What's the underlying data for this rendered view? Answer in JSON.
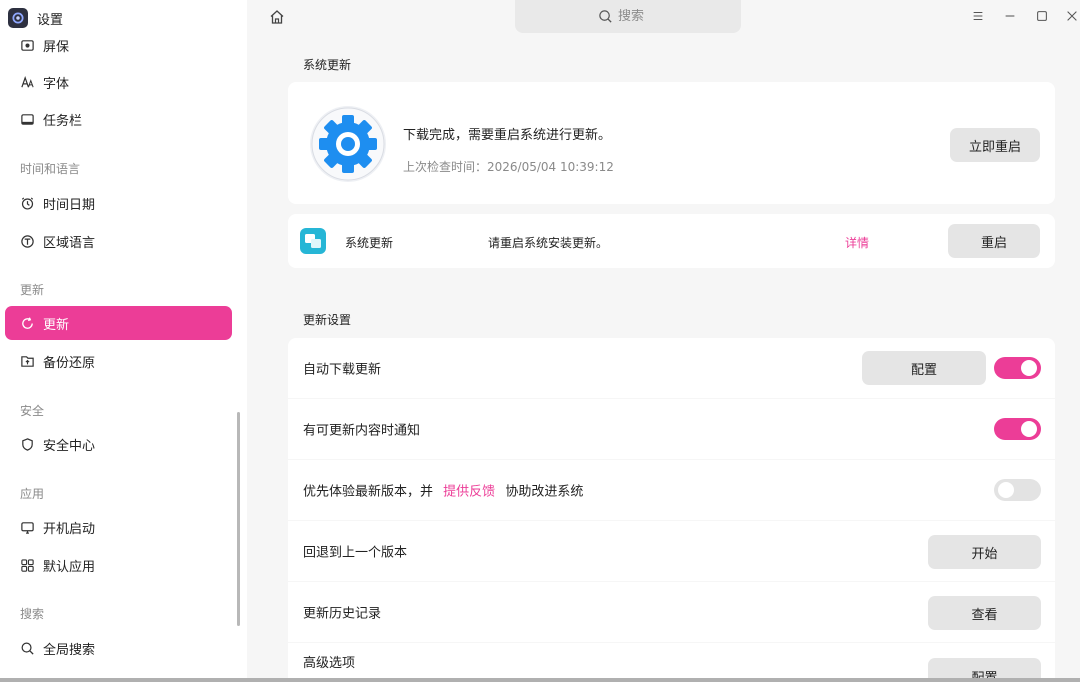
{
  "app": {
    "title": "设置"
  },
  "search": {
    "placeholder": "搜索"
  },
  "sidebar": {
    "items_top": [
      {
        "label": "屏保",
        "icon": "screensaver-icon"
      },
      {
        "label": "字体",
        "icon": "font-icon"
      },
      {
        "label": "任务栏",
        "icon": "taskbar-icon"
      }
    ],
    "section_time": "时间和语言",
    "items_time": [
      {
        "label": "时间日期",
        "icon": "clock-icon"
      },
      {
        "label": "区域语言",
        "icon": "language-icon"
      }
    ],
    "section_update": "更新",
    "items_update": [
      {
        "label": "更新",
        "icon": "refresh-icon"
      },
      {
        "label": "备份还原",
        "icon": "backup-icon"
      }
    ],
    "section_security": "安全",
    "items_security": [
      {
        "label": "安全中心",
        "icon": "shield-icon"
      }
    ],
    "section_apps": "应用",
    "items_apps": [
      {
        "label": "开机启动",
        "icon": "startup-icon"
      },
      {
        "label": "默认应用",
        "icon": "apps-grid-icon"
      }
    ],
    "section_search": "搜索",
    "items_search": [
      {
        "label": "全局搜索",
        "icon": "search-icon"
      }
    ]
  },
  "main": {
    "system_update": {
      "title": "系统更新",
      "status": "下载完成，需要重启系统进行更新。",
      "last_check": "上次检查时间：2026/05/04 10:39:12",
      "restart_now": "立即重启",
      "item_name": "系统更新",
      "item_message": "请重启系统安装更新。",
      "details_link": "详情",
      "restart": "重启"
    },
    "update_settings": {
      "title": "更新设置",
      "auto_download": {
        "label": "自动下载更新",
        "button": "配置",
        "enabled": true
      },
      "notify": {
        "label": "有可更新内容时通知",
        "enabled": true
      },
      "preview": {
        "prefix": "优先体验最新版本，并",
        "link": "提供反馈",
        "suffix": "协助改进系统",
        "enabled": false
      },
      "rollback": {
        "label": "回退到上一个版本",
        "button": "开始"
      },
      "history": {
        "label": "更新历史记录",
        "button": "查看"
      },
      "advanced": {
        "label": "高级选项",
        "button": "配置"
      }
    }
  },
  "colors": {
    "accent": "#ec3d97",
    "background": "#f6f6f6",
    "card": "#ffffff",
    "button": "#e5e5e5"
  }
}
